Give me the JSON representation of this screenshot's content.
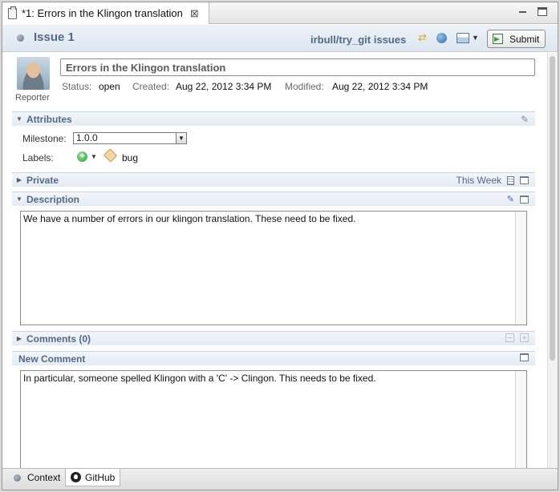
{
  "tab": {
    "title": "*1: Errors in the Klingon translation",
    "close": "⊠"
  },
  "header": {
    "issue_title": "Issue 1",
    "repo": "irbull/try_git issues",
    "submit_label": "Submit"
  },
  "summary": {
    "value": "Errors in the Klingon translation",
    "reporter_label": "Reporter",
    "status_label": "Status:",
    "status_value": "open",
    "created_label": "Created:",
    "created_value": "Aug 22, 2012 3:34 PM",
    "modified_label": "Modified:",
    "modified_value": "Aug 22, 2012 3:34 PM"
  },
  "attributes": {
    "title": "Attributes",
    "milestone_label": "Milestone:",
    "milestone_value": "1.0.0",
    "labels_label": "Labels:",
    "labels": [
      "bug"
    ]
  },
  "private": {
    "title": "Private",
    "this_week": "This Week"
  },
  "description": {
    "title": "Description",
    "text": "We have a number of errors in our klingon translation. These need to be fixed."
  },
  "comments": {
    "title": "Comments (0)"
  },
  "new_comment": {
    "title": "New Comment",
    "text": "In particular, someone spelled Klingon with a 'C' -> Clingon.  This needs to be fixed."
  },
  "bottom_tabs": {
    "context": "Context",
    "github": "GitHub"
  },
  "icons": {
    "issue": "issue-dot-icon",
    "sync": "synchronize-icon",
    "browser": "globe-icon",
    "layout": "layout-icon",
    "submit": "submit-icon",
    "add_label": "add-label-icon",
    "tag": "tag-icon"
  },
  "colors": {
    "section_title": "#516a86",
    "header_bg": "#dde6f0",
    "border": "#8c8c8c"
  }
}
